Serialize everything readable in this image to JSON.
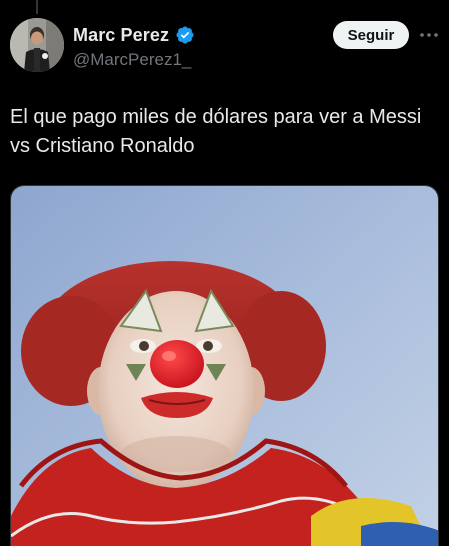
{
  "author": {
    "display_name": "Marc Perez",
    "handle": "@MarcPerez1_",
    "verified": true,
    "verified_color": "#1d9bf0"
  },
  "actions": {
    "follow_label": "Seguir",
    "more_icon": "more-horizontal-icon"
  },
  "post": {
    "text": "El que pago miles de dólares para ver a Messi vs Cristiano Ronaldo"
  },
  "media": {
    "type": "image",
    "description_icon": "clown-meme-image"
  },
  "colors": {
    "background": "#000000",
    "text_primary": "#e7e9ea",
    "text_secondary": "#71767b",
    "follow_bg": "#eff3f4"
  }
}
